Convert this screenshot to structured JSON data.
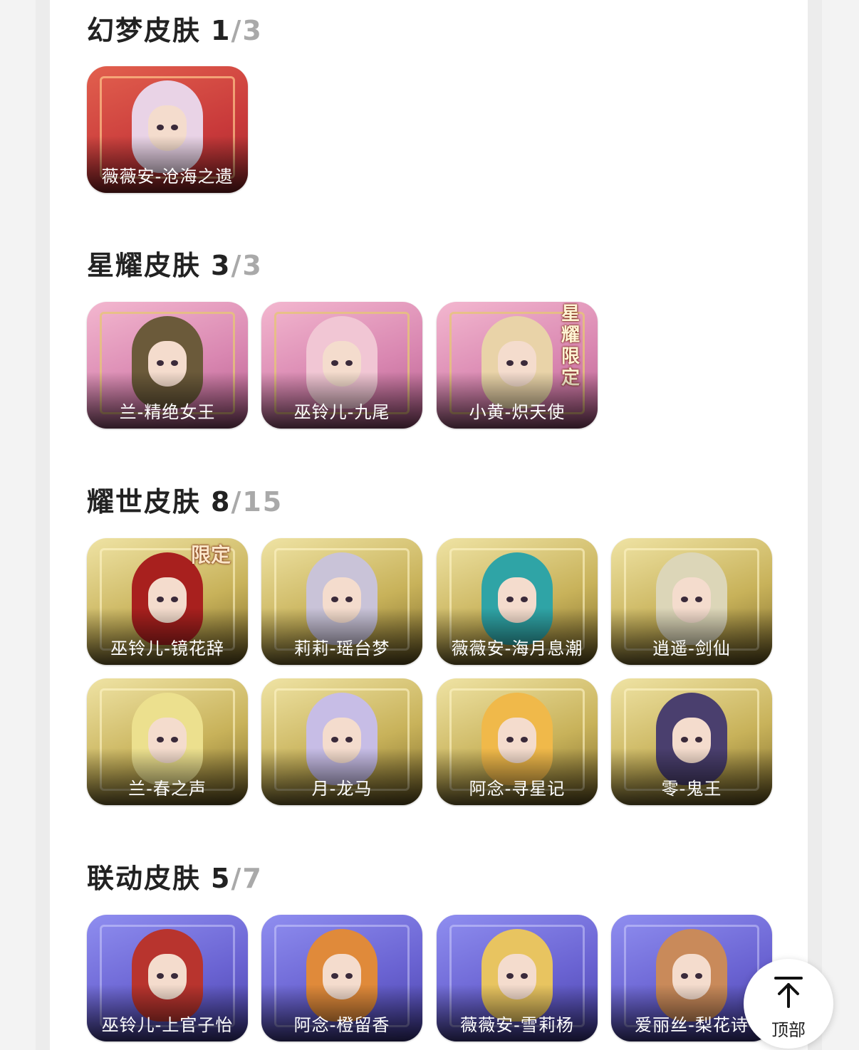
{
  "sections": [
    {
      "title": "幻梦皮肤",
      "owned": "1",
      "total": "/3",
      "skins": [
        {
          "label": "薇薇安-沧海之遗"
        }
      ]
    },
    {
      "title": "星耀皮肤",
      "owned": "3",
      "total": "/3",
      "skins": [
        {
          "label": "兰-精绝女王"
        },
        {
          "label": "巫铃儿-九尾"
        },
        {
          "label": "小黄-炽天使",
          "badge": "星耀限定"
        }
      ]
    },
    {
      "title": "耀世皮肤",
      "owned": "8",
      "total": "/15",
      "skins": [
        {
          "label": "巫铃儿-镜花辞",
          "badge": "限定"
        },
        {
          "label": "莉莉-瑶台梦"
        },
        {
          "label": "薇薇安-海月息潮"
        },
        {
          "label": "逍遥-剑仙"
        },
        {
          "label": "兰-春之声"
        },
        {
          "label": "月-龙马"
        },
        {
          "label": "阿念-寻星记"
        },
        {
          "label": "零-鬼王"
        }
      ]
    },
    {
      "title": "联动皮肤",
      "owned": "5",
      "total": "/7",
      "skins": [
        {
          "label": "巫铃儿-上官子怡"
        },
        {
          "label": "阿念-橙留香"
        },
        {
          "label": "薇薇安-雪莉杨"
        },
        {
          "label": "爱丽丝-梨花诗"
        }
      ]
    }
  ],
  "top_button": {
    "label": "顶部",
    "icon": "arrow-up-to-top-icon"
  },
  "colors": {
    "background": "#f3f3f3",
    "panel": "#ffffff",
    "title": "#222222",
    "total_count": "#a9a9a9"
  }
}
